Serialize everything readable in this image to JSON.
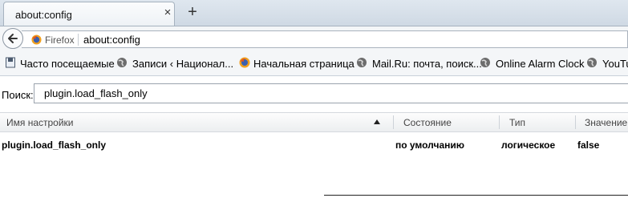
{
  "tab": {
    "title": "about:config",
    "close_glyph": "×",
    "new_tab_glyph": "+"
  },
  "navbar": {
    "identity_label": "Firefox",
    "url": "about:config"
  },
  "bookmarks": [
    {
      "label": "Часто посещаемые",
      "icon": "bookmark-folder-icon"
    },
    {
      "label": "Записи ‹ Национал...",
      "icon": "globe-icon"
    },
    {
      "label": "Начальная страница",
      "icon": "firefox-icon"
    },
    {
      "label": "Mail.Ru: почта, поиск...",
      "icon": "globe-icon"
    },
    {
      "label": "Online Alarm Clock",
      "icon": "globe-icon"
    },
    {
      "label": "YouTu",
      "icon": "globe-icon"
    }
  ],
  "search": {
    "label": "Поиск:",
    "value": "plugin.load_flash_only"
  },
  "table": {
    "columns": [
      "Имя настройки",
      "Состояние",
      "Тип",
      "Значение"
    ],
    "rows": [
      {
        "name": "plugin.load_flash_only",
        "status": "по умолчанию",
        "type": "логическое",
        "value": "false"
      }
    ]
  },
  "colors": {
    "tab_strip": "#dfe7ef",
    "toolbar": "#f4f6f8",
    "border": "#a6b2bf"
  }
}
